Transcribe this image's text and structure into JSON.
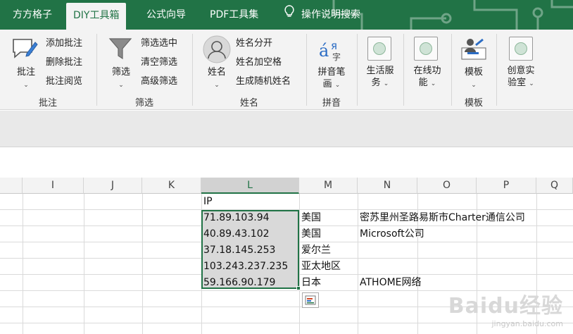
{
  "tabs": [
    {
      "label": "方方格子",
      "active": false
    },
    {
      "label": "DIY工具箱",
      "active": true
    },
    {
      "label": "公式向导",
      "active": false
    },
    {
      "label": "PDF工具集",
      "active": false
    },
    {
      "label": "操作说明搜索",
      "active": false
    }
  ],
  "ribbon": {
    "annotate": {
      "big": "批注",
      "items": [
        "添加批注",
        "删除批注",
        "批注阅览"
      ],
      "group": "批注"
    },
    "filter": {
      "big": "筛选",
      "items": [
        "筛选选中",
        "清空筛选",
        "高级筛选"
      ],
      "group": "筛选"
    },
    "name": {
      "big": "姓名",
      "items": [
        "姓名分开",
        "姓名加空格",
        "生成随机姓名"
      ],
      "group": "姓名"
    },
    "pinyin": {
      "big_line1": "拼音笔",
      "big_line2": "画",
      "group": "拼音"
    },
    "life": {
      "line1": "生活服",
      "line2": "务"
    },
    "online": {
      "line1": "在线功",
      "line2": "能"
    },
    "template": {
      "big": "模板",
      "group": "模板"
    },
    "lab": {
      "line1": "创意实",
      "line2": "验室"
    }
  },
  "columns": [
    "I",
    "J",
    "K",
    "L",
    "M",
    "N",
    "O",
    "P",
    "Q"
  ],
  "selected_column": "L",
  "rows": [
    {
      "l": "IP",
      "m": "",
      "n": ""
    },
    {
      "l": "71.89.103.94",
      "m": "美国",
      "n": "密苏里州圣路易斯市Charter通信公司"
    },
    {
      "l": "40.89.43.102",
      "m": "美国",
      "n": "Microsoft公司"
    },
    {
      "l": "37.18.145.253",
      "m": "爱尔兰",
      "n": ""
    },
    {
      "l": "103.243.237.235",
      "m": "亚太地区",
      "n": ""
    },
    {
      "l": "59.166.90.179",
      "m": "日本",
      "n": "ATHOME网络"
    }
  ],
  "watermark": {
    "line1": "Baidu经验",
    "line2": "jingyan.baidu.com"
  },
  "colors": {
    "accent": "#217346",
    "selection": "#d9d9d9"
  }
}
